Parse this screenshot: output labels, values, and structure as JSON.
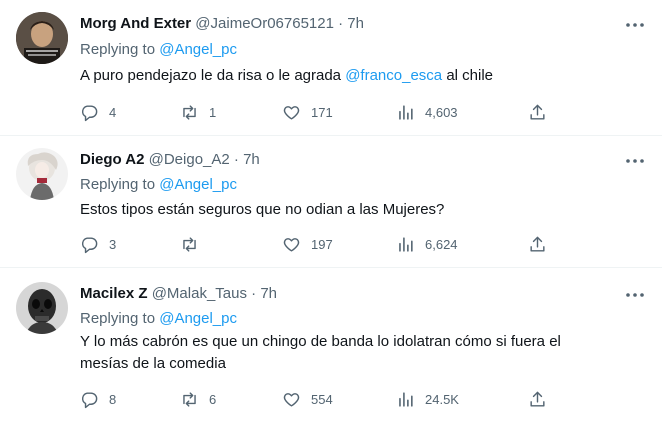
{
  "tweets": [
    {
      "name": "Morg And Exter",
      "handle": "@JaimeOr06765121",
      "dot": "·",
      "time": "7h",
      "replying_prefix": "Replying to",
      "replying_to": "@Angel_pc",
      "text_before": "A puro pendejazo le da risa o le agrada",
      "mention": "@franco_esca",
      "text_after": "al chile",
      "replies": "4",
      "retweets": "1",
      "likes": "171",
      "views": "4,603"
    },
    {
      "name": "Diego A2",
      "handle": "@Deigo_A2",
      "dot": "·",
      "time": "7h",
      "replying_prefix": "Replying to",
      "replying_to": "@Angel_pc",
      "text": "Estos tipos están seguros que no odian a las Mujeres?",
      "replies": "3",
      "retweets": "",
      "likes": "197",
      "views": "6,624"
    },
    {
      "name": "Macilex Z",
      "handle": "@Malak_Taus",
      "dot": "·",
      "time": "7h",
      "replying_prefix": "Replying to",
      "replying_to": "@Angel_pc",
      "text_line1": "Y lo más cabrón es que un chingo de banda lo idolatran cómo si fuera el",
      "text_line2": "mesías de la comedia",
      "replies": "8",
      "retweets": "6",
      "likes": "554",
      "views": "24.5K"
    }
  ],
  "icons": {
    "reply": "reply-icon",
    "retweet": "retweet-icon",
    "like": "heart-icon",
    "views": "views-icon",
    "share": "share-icon",
    "more": "more-options-icon"
  },
  "colors": {
    "text": "#0f1419",
    "secondary": "#536471",
    "link": "#1d9bf0",
    "divider": "#eff3f4"
  }
}
